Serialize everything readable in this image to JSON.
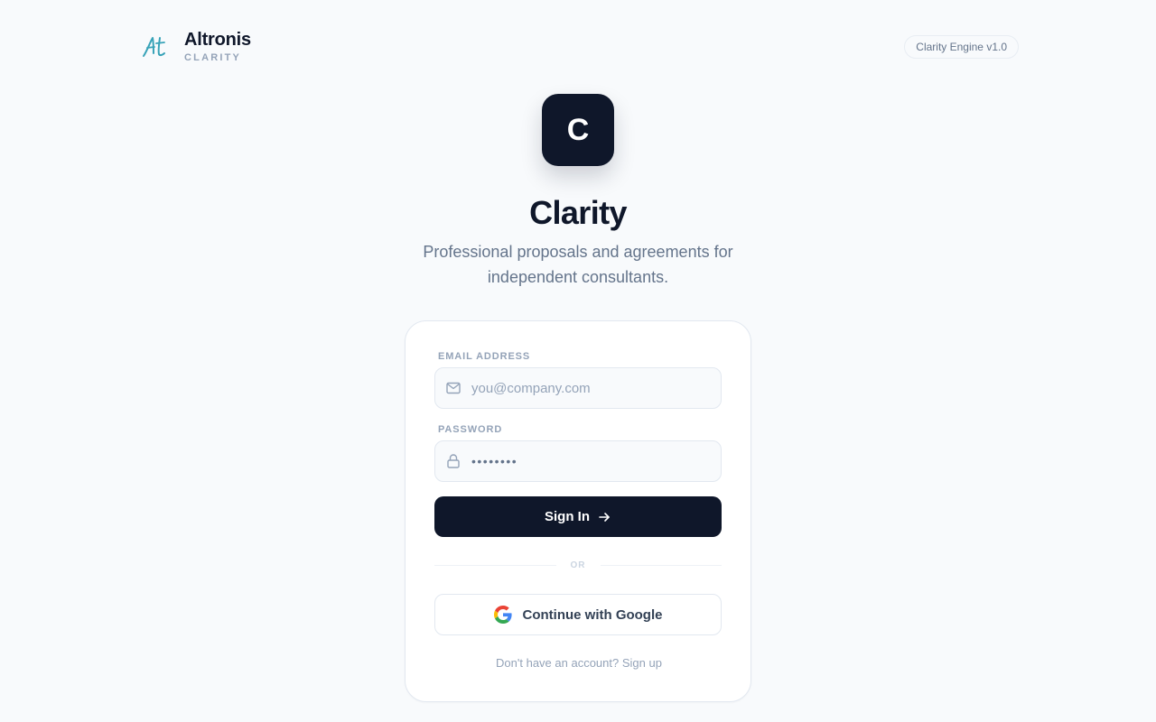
{
  "brand": {
    "logo_icon": "altronis-script-logo-icon",
    "name": "Altronis",
    "sub": "CLARITY",
    "accent_color": "#38a3b8"
  },
  "version_badge": "Clarity Engine v1.0",
  "app": {
    "icon_letter": "C",
    "title": "Clarity",
    "subtitle": "Professional proposals and agreements for independent consultants."
  },
  "form": {
    "email": {
      "label": "EMAIL ADDRESS",
      "placeholder": "you@company.com",
      "value": "",
      "icon": "mail-icon"
    },
    "password": {
      "label": "PASSWORD",
      "value": "••••••••",
      "icon": "lock-icon"
    },
    "signin_label": "Sign In",
    "signin_icon": "arrow-right-icon",
    "divider": "OR",
    "google_label": "Continue with Google",
    "google_icon": "google-icon",
    "signup_prompt": "Don't have an account?",
    "signup_link": "Sign up"
  },
  "colors": {
    "primary": "#0f172a",
    "background": "#f8fafc",
    "muted": "#94a3b8",
    "border": "#e2e8f0"
  }
}
